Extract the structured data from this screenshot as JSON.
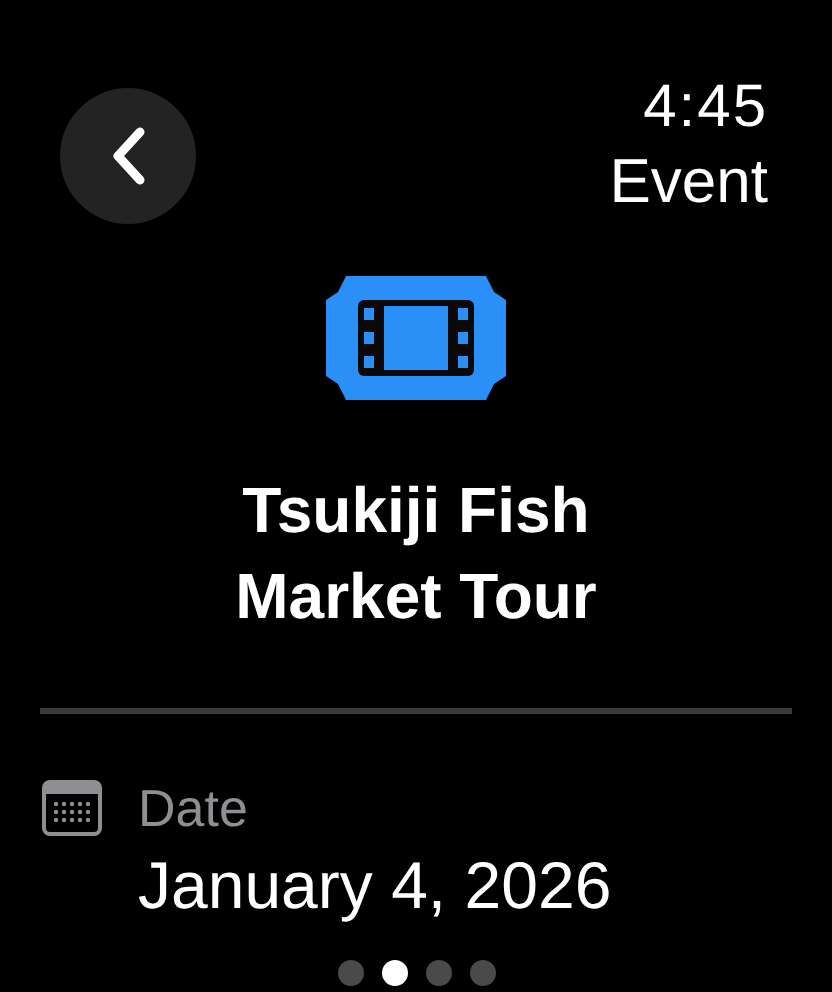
{
  "status_bar": {
    "time": "4:45",
    "title": "Event"
  },
  "event": {
    "title": "Tsukiji Fish Market Tour"
  },
  "details": [
    {
      "label": "Date",
      "value": "January 4, 2026"
    }
  ],
  "page_dots": [
    {
      "selected": false
    },
    {
      "selected": true
    },
    {
      "selected": false
    },
    {
      "selected": false
    }
  ]
}
